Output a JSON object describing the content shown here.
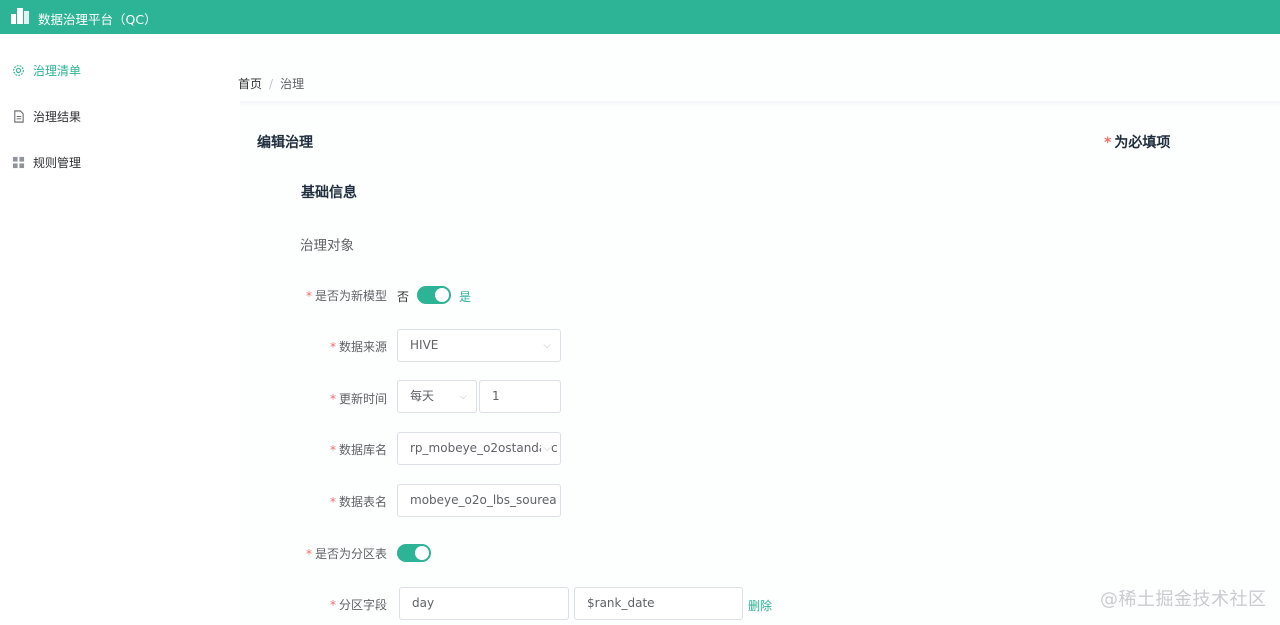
{
  "app": {
    "title": "数据治理平台（QC）",
    "logo_icon": "building-icon"
  },
  "colors": {
    "brand": "#2db395",
    "required": "#f56c6c"
  },
  "sidebar": {
    "items": [
      {
        "label": "治理清单",
        "icon": "gear-icon",
        "active": true
      },
      {
        "label": "治理结果",
        "icon": "document-icon",
        "active": false
      },
      {
        "label": "规则管理",
        "icon": "grid-icon",
        "active": false
      }
    ]
  },
  "breadcrumb": {
    "home": "首页",
    "separator": "/",
    "current": "治理"
  },
  "page": {
    "title": "编辑治理",
    "required_star": "*",
    "required_note": "为必填项"
  },
  "section": {
    "title": "基础信息",
    "subtitle": "治理对象"
  },
  "form": {
    "is_new_model": {
      "label": "是否为新模型",
      "off_text": "否",
      "on_text": "是",
      "value": true
    },
    "data_source": {
      "label": "数据来源",
      "value": "HIVE"
    },
    "update_time": {
      "label": "更新时间",
      "frequency": "每天",
      "value": "1"
    },
    "database": {
      "label": "数据库名",
      "value": "rp_mobeye_o2ostandarc"
    },
    "table": {
      "label": "数据表名",
      "value": "mobeye_o2o_lbs_sourea"
    },
    "is_partitioned": {
      "label": "是否为分区表",
      "value": true
    },
    "partition": {
      "label": "分区字段",
      "field": "day",
      "value": "$rank_date",
      "delete_label": "删除"
    }
  },
  "watermark": "@稀土掘金技术社区"
}
